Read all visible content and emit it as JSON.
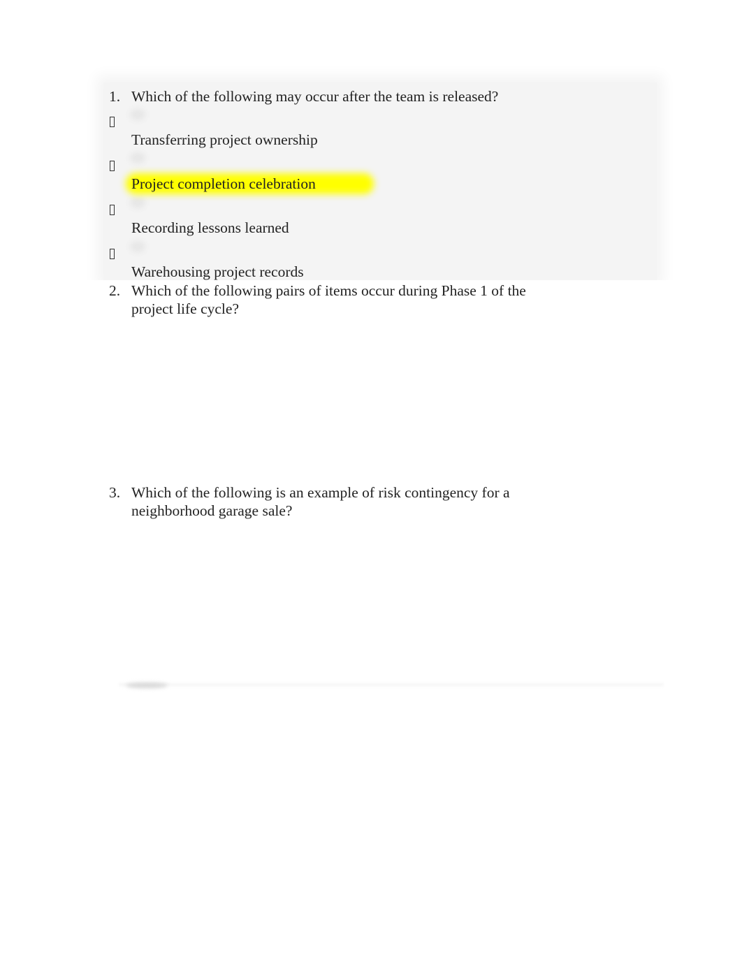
{
  "questions": [
    {
      "number": "1.",
      "text": "Which of the following may occur after the team is released?",
      "options": [
        {
          "bullet_icon": "missing-glyph-box",
          "label": "Transferring project ownership",
          "highlighted": false
        },
        {
          "bullet_icon": "missing-glyph-box",
          "label": "Project completion celebration",
          "highlighted": true
        },
        {
          "bullet_icon": "missing-glyph-box",
          "label": "Recording lessons learned",
          "highlighted": false
        },
        {
          "bullet_icon": "missing-glyph-box",
          "label": "Warehousing project records",
          "highlighted": false
        }
      ]
    },
    {
      "number": "2.",
      "text_line1": "Which of the following pairs of items occur during Phase 1 of the",
      "text_line2": "project life cycle?"
    },
    {
      "number": "3.",
      "text_line1": "Which of the following is an example of risk contingency for a",
      "text_line2": "neighborhood garage sale?"
    }
  ],
  "colors": {
    "highlight": "#ffff00",
    "blurred_panel": "#f4f4f4",
    "text": "#222222"
  }
}
